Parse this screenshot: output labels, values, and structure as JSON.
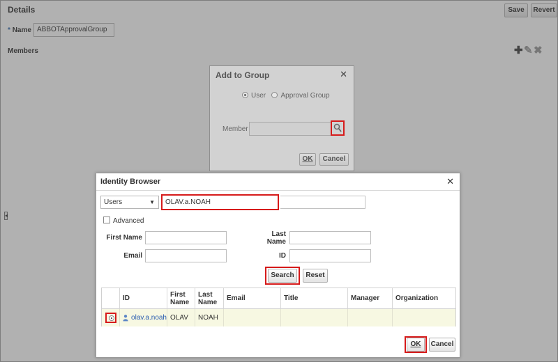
{
  "page": {
    "title": "Details",
    "save_label": "Save",
    "revert_label": "Revert",
    "name_required_mark": "*",
    "name_label": "Name",
    "name_value": "ABBOTApprovalGroup",
    "members_label": "Members",
    "members_icons": [
      "plus-icon",
      "pencil-icon",
      "delete-icon"
    ]
  },
  "add_to_group": {
    "title": "Add to Group",
    "radio_user": "User",
    "radio_group": "Approval Group",
    "selected_radio": "User",
    "member_label": "Member",
    "member_value": "",
    "ok_label": "OK",
    "cancel_label": "Cancel"
  },
  "identity_browser": {
    "title": "Identity Browser",
    "type_select": "Users",
    "search_value": "OLAV.a.NOAH",
    "advanced_label": "Advanced",
    "advanced_checked": false,
    "first_name_label": "First Name",
    "last_name_label_1": "Last",
    "last_name_label_2": "Name",
    "email_label": "Email",
    "id_label": "ID",
    "first_name_value": "",
    "last_name_value": "",
    "email_value": "",
    "id_value": "",
    "search_button": "Search",
    "reset_button": "Reset",
    "columns": {
      "id": "ID",
      "first_1": "First",
      "first_2": "Name",
      "last_1": "Last",
      "last_2": "Name",
      "email": "Email",
      "title": "Title",
      "manager": "Manager",
      "organization": "Organization"
    },
    "rows": [
      {
        "selected": true,
        "id": "olav.a.noah",
        "first_name": "OLAV",
        "last_name": "NOAH",
        "email": "",
        "title": "",
        "manager": "",
        "organization": ""
      }
    ],
    "ok_label": "OK",
    "cancel_label": "Cancel"
  },
  "colors": {
    "highlight_outline": "#d61a1a",
    "link": "#2a5db0",
    "selected_row": "#f7f8e2",
    "overlay": "#464646"
  }
}
